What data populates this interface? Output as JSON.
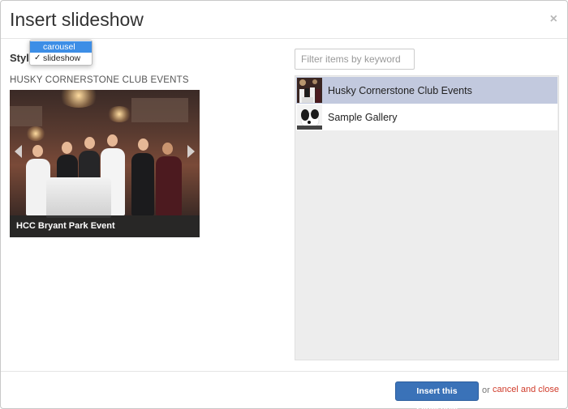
{
  "modal": {
    "title": "Insert slideshow",
    "close_icon": "close-icon",
    "close_glyph": "×"
  },
  "style": {
    "label": "Style",
    "options": [
      {
        "label": "carousel",
        "highlighted": true,
        "selected": false
      },
      {
        "label": "slideshow",
        "highlighted": false,
        "selected": true
      }
    ],
    "check_glyph": "✓"
  },
  "preview": {
    "heading": "HUSKY CORNERSTONE CLUB EVENTS",
    "caption": "HCC Bryant Park Event",
    "prev_icon": "chevron-left-icon",
    "next_icon": "chevron-right-icon"
  },
  "filter": {
    "placeholder": "Filter items by keyword",
    "value": ""
  },
  "galleries": [
    {
      "label": "Husky Cornerstone Club Events",
      "selected": true,
      "thumb": "event-photo-thumbnail"
    },
    {
      "label": "Sample Gallery",
      "selected": false,
      "thumb": "dog-photo-thumbnail"
    }
  ],
  "footer": {
    "insert_label": "Insert this slideshow",
    "or_text": "or",
    "cancel_label": "cancel and close"
  },
  "colors": {
    "primary_button": "#3a72b8",
    "selected_row": "#c2c9de",
    "cancel_link": "#d03b2a",
    "dropdown_highlight": "#3d8ee6"
  }
}
